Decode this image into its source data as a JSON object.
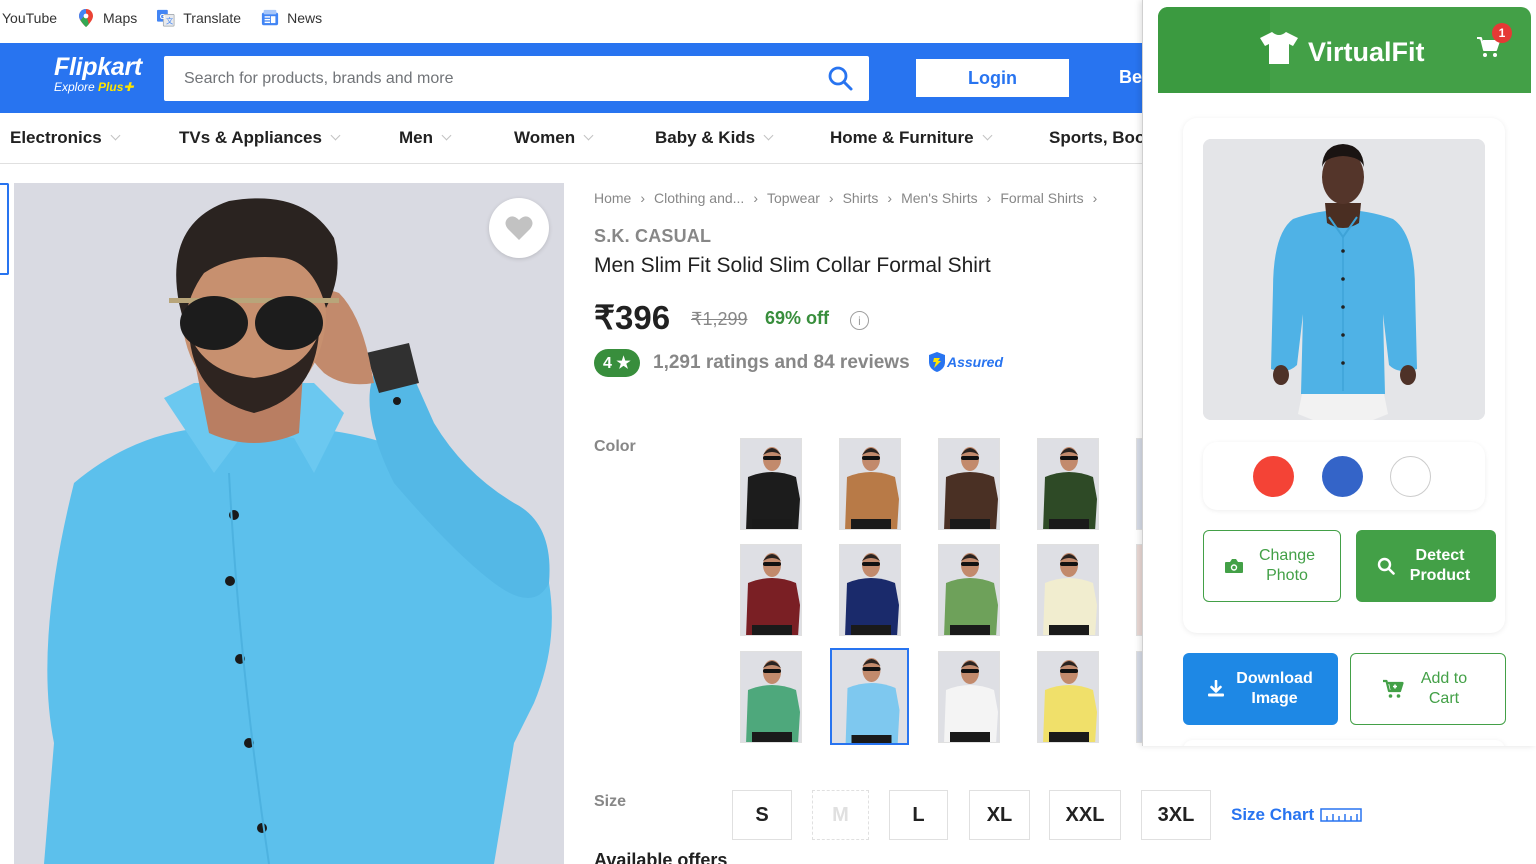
{
  "bookmarks": [
    {
      "label": "YouTube",
      "icon": "none"
    },
    {
      "label": "Maps",
      "icon": "maps-pin-icon"
    },
    {
      "label": "Translate",
      "icon": "translate-icon"
    },
    {
      "label": "News",
      "icon": "news-icon"
    }
  ],
  "header": {
    "logo": "Flipkart",
    "logo_sub_a": "Explore",
    "logo_sub_b": "Plus",
    "search_placeholder": "Search for products, brands and more",
    "login": "Login",
    "become": "Be",
    "color": "#2874f0"
  },
  "categories": [
    "Electronics",
    "TVs & Appliances",
    "Men",
    "Women",
    "Baby & Kids",
    "Home & Furniture",
    "Sports, Boo"
  ],
  "breadcrumbs": [
    "Home",
    "Clothing and...",
    "Topwear",
    "Shirts",
    "Men's Shirts",
    "Formal Shirts"
  ],
  "product": {
    "brand": "S.K. CASUAL",
    "title": "Men Slim Fit Solid Slim Collar Formal Shirt",
    "price": "₹396",
    "mrp": "₹1,299",
    "discount": "69% off",
    "rating": "4 ★",
    "reviews": "1,291 ratings and 84 reviews",
    "assured": "Assured",
    "color_label": "Color",
    "swatch_colors": [
      "#1c1c1c",
      "#b87a47",
      "#4a3024",
      "#2e4a26",
      "#7a1f24",
      "#1a2a6b",
      "#6ea15a",
      "#f1edcf",
      "#4ea87c",
      "#7ec8ef",
      "#f4f4f4",
      "#f0e06a"
    ],
    "size_label": "Size",
    "sizes": [
      "S",
      "M",
      "L",
      "XL",
      "XXL",
      "3XL"
    ],
    "size_chart": "Size Chart",
    "offers": "Available offers",
    "shirt_color": "#5cc0ec"
  },
  "virtualfit": {
    "title": "VirtualFit",
    "cart_count": "1",
    "accent": "#43a047",
    "colors": [
      "#f44336",
      "#3464c8",
      "#ffffff"
    ],
    "change_photo": "Change Photo",
    "detect_product": "Detect Product",
    "download_image": "Download Image",
    "add_to_cart": "Add to Cart"
  }
}
